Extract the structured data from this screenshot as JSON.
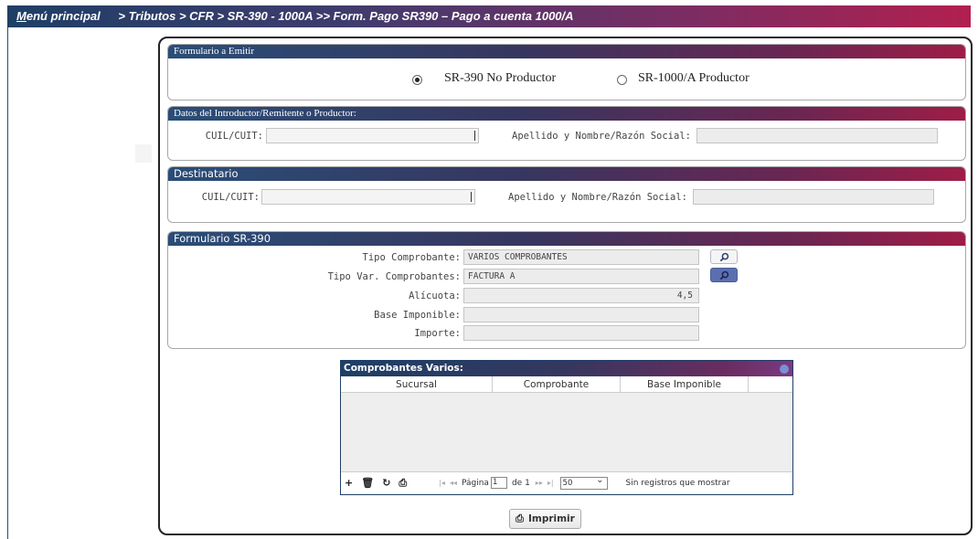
{
  "breadcrumb": {
    "menu_first": "M",
    "menu_rest": "enú principal",
    "path": "> Tributos > CFR  > SR-390 - 1000A >> Form. Pago SR390 – Pago a cuenta 1000/A"
  },
  "form_emitir": {
    "title": "Formulario a Emitir",
    "option1": "SR-390 No Productor",
    "option2": "SR-1000/A Productor",
    "selected": "SR-390 No Productor"
  },
  "introductor": {
    "title": "Datos del Introductor/Remitente o Productor:",
    "cuit_label": "CUIL/CUIT:",
    "cuit_value": "",
    "name_label": "Apellido y Nombre/Razón Social:",
    "name_value": ""
  },
  "destinatario": {
    "title": "Destinatario",
    "cuit_label": "CUIL/CUIT:",
    "cuit_value": "",
    "name_label": "Apellido y Nombre/Razón Social:",
    "name_value": ""
  },
  "sr390": {
    "title": "Formulario SR-390",
    "tipo_label": "Tipo Comprobante:",
    "tipo_value": "VARIOS COMPROBANTES",
    "tipovar_label": "Tipo Var. Comprobantes:",
    "tipovar_value": "FACTURA A",
    "alicuota_label": "Alícuota:",
    "alicuota_value": "4,5",
    "base_label": "Base Imponible:",
    "base_value": "",
    "importe_label": "Importe:",
    "importe_value": ""
  },
  "grid": {
    "title": "Comprobantes Varios:",
    "columns": [
      "Sucursal",
      "Comprobante",
      "Base Imponible"
    ],
    "pager": {
      "pagina_label": "Página",
      "page": "1",
      "de_label": "de 1",
      "page_size": "50",
      "empty_msg": "Sin registros que mostrar"
    }
  },
  "print_button": "Imprimir",
  "icons": {
    "add": "plus-icon",
    "delete": "trash-icon",
    "refresh": "refresh-icon",
    "print": "printer-icon",
    "search": "search-icon"
  },
  "colors": {
    "header_start": "#1f3f66",
    "header_end": "#b1204f",
    "active_button": "#5b6fb0"
  }
}
